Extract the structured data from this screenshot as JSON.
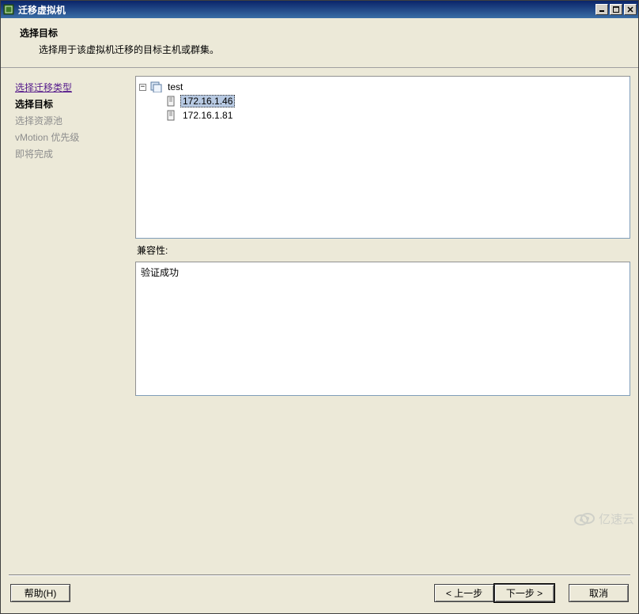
{
  "window": {
    "title": "迁移虚拟机"
  },
  "header": {
    "title": "选择目标",
    "description": "选择用于该虚拟机迁移的目标主机或群集。"
  },
  "wizard": {
    "steps": [
      {
        "label": "选择迁移类型",
        "state": "completed"
      },
      {
        "label": "选择目标",
        "state": "current"
      },
      {
        "label": "选择资源池",
        "state": "pending"
      },
      {
        "label": "vMotion 优先级",
        "state": "pending"
      },
      {
        "label": "即将完成",
        "state": "pending"
      }
    ]
  },
  "tree": {
    "root_toggle": "−",
    "root_label": "test",
    "children": [
      {
        "label": "172.16.1.46",
        "selected": true
      },
      {
        "label": "172.16.1.81",
        "selected": false
      }
    ]
  },
  "compatibility": {
    "label": "兼容性:",
    "message": "验证成功"
  },
  "buttons": {
    "help": "帮助(H)",
    "back": "< 上一步",
    "next": "下一步 >",
    "cancel": "取消"
  },
  "watermark": "亿速云"
}
